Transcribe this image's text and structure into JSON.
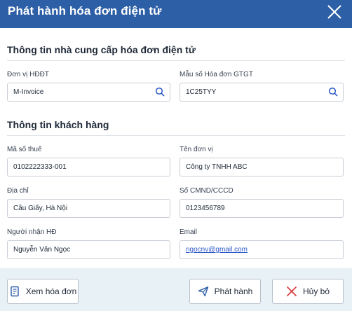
{
  "dialog": {
    "title": "Phát hành hóa đơn điện tử"
  },
  "provider_section": {
    "title": "Thông tin nhà cung cấp hóa đơn điện tử",
    "fields": {
      "provider": {
        "label": "Đơn vị HĐĐT",
        "value": "M-Invoice"
      },
      "template": {
        "label": "Mẫu số Hóa đơn GTGT",
        "value": "1C25TYY"
      }
    }
  },
  "customer_section": {
    "title": "Thông tin khách hàng",
    "fields": {
      "tax_code": {
        "label": "Mã số thuế",
        "value": "0102222333-001"
      },
      "company_name": {
        "label": "Tên đơn vị",
        "value": "Công ty TNHH ABC"
      },
      "address": {
        "label": "Địa chỉ",
        "value": "Cầu Giấy, Hà Nội"
      },
      "id_number": {
        "label": "Số CMND/CCCD",
        "value": "0123456789"
      },
      "recipient": {
        "label": "Người nhận HĐ",
        "value": "Nguyễn Văn Ngọc"
      },
      "email": {
        "label": "Email",
        "value": "ngocnv@gmail.com"
      }
    }
  },
  "footer": {
    "view_invoice_label": "Xem hóa đơn",
    "issue_label": "Phát hành",
    "cancel_label": "Hủy bỏ"
  },
  "icons": {
    "close": "close-icon",
    "search": "search-icon",
    "invoice": "invoice-icon",
    "send": "send-icon",
    "cancel": "x-icon"
  },
  "colors": {
    "header_bg": "#2d5fa6",
    "footer_bg": "#e7f1f6",
    "accent_blue": "#2b58c8",
    "cancel_red": "#d94141"
  }
}
